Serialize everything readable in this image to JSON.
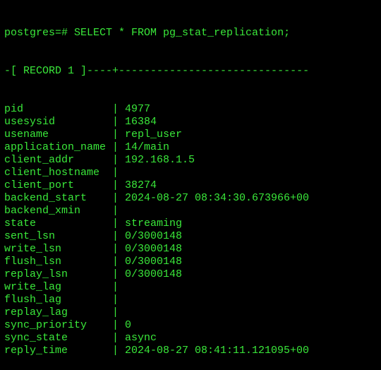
{
  "prompt": "postgres=# SELECT * FROM pg_stat_replication;",
  "record_header": "-[ RECORD 1 ]----+------------------------------",
  "separator": "| ",
  "rows": [
    {
      "key": "pid",
      "value": "4977"
    },
    {
      "key": "usesysid",
      "value": "16384"
    },
    {
      "key": "usename",
      "value": "repl_user"
    },
    {
      "key": "application_name",
      "value": "14/main"
    },
    {
      "key": "client_addr",
      "value": "192.168.1.5"
    },
    {
      "key": "client_hostname",
      "value": ""
    },
    {
      "key": "client_port",
      "value": "38274"
    },
    {
      "key": "backend_start",
      "value": "2024-08-27 08:34:30.673966+00"
    },
    {
      "key": "backend_xmin",
      "value": ""
    },
    {
      "key": "state",
      "value": "streaming"
    },
    {
      "key": "sent_lsn",
      "value": "0/3000148"
    },
    {
      "key": "write_lsn",
      "value": "0/3000148"
    },
    {
      "key": "flush_lsn",
      "value": "0/3000148"
    },
    {
      "key": "replay_lsn",
      "value": "0/3000148"
    },
    {
      "key": "write_lag",
      "value": ""
    },
    {
      "key": "flush_lag",
      "value": ""
    },
    {
      "key": "replay_lag",
      "value": ""
    },
    {
      "key": "sync_priority",
      "value": "0"
    },
    {
      "key": "sync_state",
      "value": "async"
    },
    {
      "key": "reply_time",
      "value": "2024-08-27 08:41:11.121095+00"
    }
  ]
}
